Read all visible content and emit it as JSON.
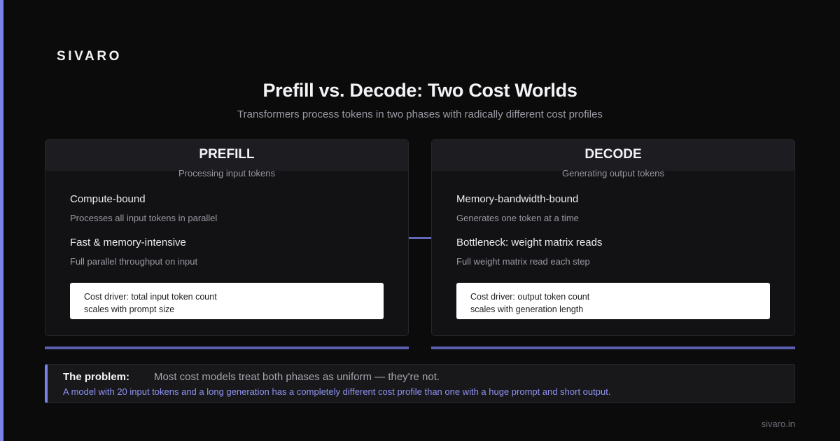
{
  "brand": "SIVARO",
  "title": "Prefill vs. Decode: Two Cost Worlds",
  "subtitle": "Transformers process tokens in two phases with radically different cost profiles",
  "colors": {
    "accent": "#7b82e8",
    "background": "#0b0b0c",
    "card": "#121214",
    "detail_text": "#8e93f0"
  },
  "phases": [
    {
      "title": "PREFILL",
      "subtitle": "Processing input tokens",
      "points": [
        {
          "head": "Compute-bound",
          "desc": "Processes all input tokens in parallel"
        },
        {
          "head": "Fast & memory-intensive",
          "desc": "Full parallel throughput on input"
        }
      ],
      "cost_line1": "Cost driver: total input token count",
      "cost_line2": "scales with prompt size"
    },
    {
      "title": "DECODE",
      "subtitle": "Generating output tokens",
      "points": [
        {
          "head": "Memory-bandwidth-bound",
          "desc": "Generates one token at a time"
        },
        {
          "head": "Bottleneck: weight matrix reads",
          "desc": "Full weight matrix read each step"
        }
      ],
      "cost_line1": "Cost driver: output token count",
      "cost_line2": "scales with generation length"
    }
  ],
  "problem": {
    "label": "The problem:",
    "text": "Most cost models treat both phases as uniform — they're not.",
    "detail": "A model with 20 input tokens and a long generation has a completely different cost profile than one with a huge prompt and short output."
  },
  "footer": "sivaro.in"
}
